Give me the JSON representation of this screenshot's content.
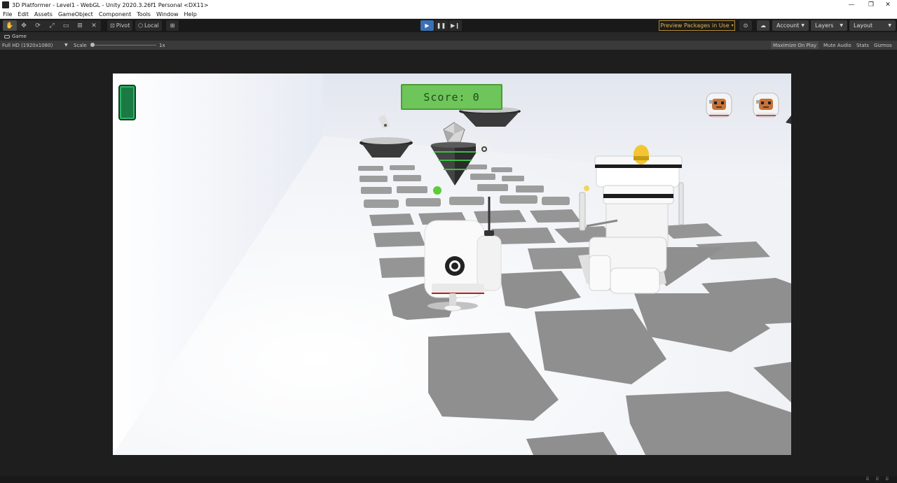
{
  "window": {
    "title": "3D Platformer - Level1 - WebGL - Unity 2020.3.26f1 Personal <DX11>",
    "minimize": "—",
    "maximize": "❐",
    "close": "✕"
  },
  "menu": {
    "items": [
      "File",
      "Edit",
      "Assets",
      "GameObject",
      "Component",
      "Tools",
      "Window",
      "Help"
    ]
  },
  "toolbar": {
    "pivot_label": "Pivot",
    "local_label": "Local",
    "preview_packages_label": "Preview Packages in Use",
    "account_label": "Account",
    "layers_label": "Layers",
    "layout_label": "Layout",
    "accent_play": "#3b6fb5"
  },
  "game_tab": {
    "label": "Game"
  },
  "game_options": {
    "resolution_label": "Full HD (1920x1080)",
    "scale_label": "Scale",
    "scale_value": "1x",
    "maximize_on_play": "Maximize On Play",
    "mute_audio": "Mute Audio",
    "stats": "Stats",
    "gizmos": "Gizmos"
  },
  "hud": {
    "score_text": "Score: 0",
    "health_color": "#1b7a44",
    "score_bg": "#6ec55a"
  }
}
